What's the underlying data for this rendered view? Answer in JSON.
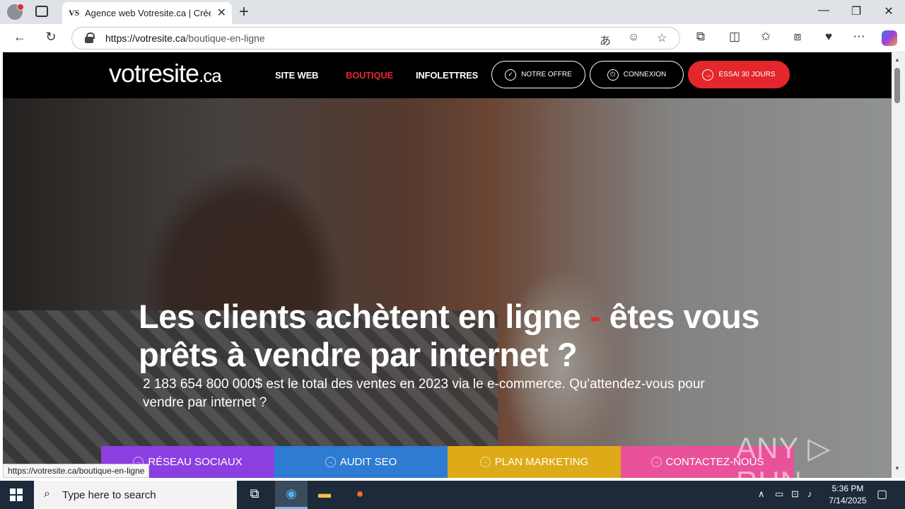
{
  "browser": {
    "tab": {
      "favicon": "VS",
      "title": "Agence web Votresite.ca | Créer m",
      "close": "✕"
    },
    "new_tab": "+",
    "window": {
      "minimize": "—",
      "restore": "❐",
      "close": "✕"
    },
    "url_domain": "https://votresite.ca",
    "url_path": "/boutique-en-ligne",
    "status_url": "https://votresite.ca/boutique-en-ligne"
  },
  "site": {
    "logo_main": "votresite",
    "logo_suffix": ".ca",
    "nav": [
      {
        "label": "SITE WEB"
      },
      {
        "label": "BOUTIQUE"
      },
      {
        "label": "INFOLETTRES"
      }
    ],
    "buttons": {
      "offer": "NOTRE OFFRE",
      "login": "CONNEXION",
      "trial": "ESSAI 30 JOURS"
    },
    "hero": {
      "title_part1": "Les clients achètent en ligne",
      "title_dash": "-",
      "title_part2": "êtes vous prêts à vendre par internet ?",
      "subtitle": "2 183 654 800 000$ est le total des ventes en 2023 via le e-commerce. Qu'attendez-vous pour vendre par internet ?"
    },
    "cta": [
      {
        "label": "RÉSEAU SOCIAUX",
        "color": "#8c3fe0"
      },
      {
        "label": "AUDIT SEO",
        "color": "#2d7bd2"
      },
      {
        "label": "PLAN MARKETING",
        "color": "#dfaa17"
      },
      {
        "label": "CONTACTEZ-NOUS",
        "color": "#e9519a"
      }
    ],
    "accent_color": "#e3272d"
  },
  "watermark": "ANY ▷ RUN",
  "taskbar": {
    "search_placeholder": "Type here to search",
    "time": "5:36 PM",
    "date": "7/14/2025"
  }
}
